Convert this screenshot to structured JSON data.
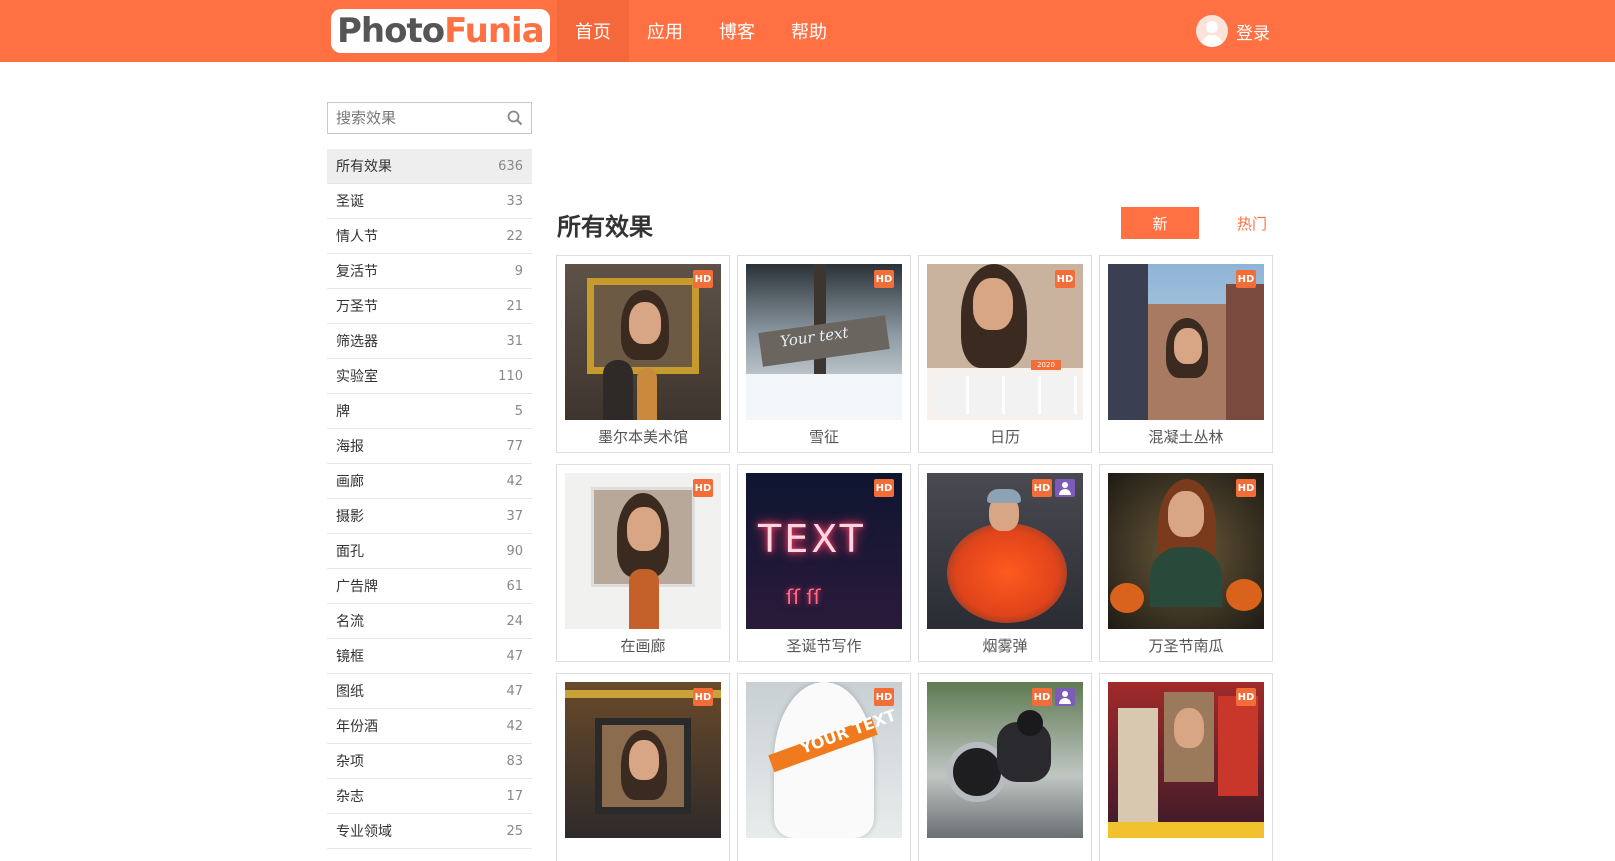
{
  "header": {
    "logo_part1": "Photo",
    "logo_part2": "Funia",
    "nav": [
      {
        "label": "首页",
        "active": true
      },
      {
        "label": "应用",
        "active": false
      },
      {
        "label": "博客",
        "active": false
      },
      {
        "label": "帮助",
        "active": false
      }
    ],
    "login_label": "登录"
  },
  "sidebar": {
    "search_placeholder": "搜索效果",
    "categories": [
      {
        "label": "所有效果",
        "count": "636",
        "active": true
      },
      {
        "label": "圣诞",
        "count": "33"
      },
      {
        "label": "情人节",
        "count": "22"
      },
      {
        "label": "复活节",
        "count": "9"
      },
      {
        "label": "万圣节",
        "count": "21"
      },
      {
        "label": "筛选器",
        "count": "31"
      },
      {
        "label": "实验室",
        "count": "110"
      },
      {
        "label": "牌",
        "count": "5"
      },
      {
        "label": "海报",
        "count": "77"
      },
      {
        "label": "画廊",
        "count": "42"
      },
      {
        "label": "摄影",
        "count": "37"
      },
      {
        "label": "面孔",
        "count": "90"
      },
      {
        "label": "广告牌",
        "count": "61"
      },
      {
        "label": "名流",
        "count": "24"
      },
      {
        "label": "镜框",
        "count": "47"
      },
      {
        "label": "图纸",
        "count": "47"
      },
      {
        "label": "年份酒",
        "count": "42"
      },
      {
        "label": "杂项",
        "count": "83"
      },
      {
        "label": "杂志",
        "count": "17"
      },
      {
        "label": "专业领域",
        "count": "25"
      }
    ]
  },
  "main": {
    "title": "所有效果",
    "sort_new": "新",
    "sort_hot": "热门",
    "hd_label": "HD",
    "effects": [
      {
        "label": "墨尔本美术馆",
        "art": "gallery-gold",
        "user_badge": false
      },
      {
        "label": "雪征",
        "art": "snow-sign",
        "user_badge": false,
        "art_text": "Your text"
      },
      {
        "label": "日历",
        "art": "calendar",
        "user_badge": false,
        "art_text": "2020"
      },
      {
        "label": "混凝土丛林",
        "art": "city",
        "user_badge": false
      },
      {
        "label": "在画廊",
        "art": "in-gallery",
        "user_badge": false
      },
      {
        "label": "圣诞节写作",
        "art": "neon-text",
        "user_badge": false,
        "art_text": "TEXT"
      },
      {
        "label": "烟雾弹",
        "art": "smoke",
        "user_badge": true
      },
      {
        "label": "万圣节南瓜",
        "art": "pumpkin",
        "user_badge": false
      },
      {
        "label": "",
        "art": "museum",
        "user_badge": false
      },
      {
        "label": "",
        "art": "surfboard",
        "user_badge": false,
        "art_text": "YOUR TEXT"
      },
      {
        "label": "",
        "art": "motorbike",
        "user_badge": true
      },
      {
        "label": "",
        "art": "billboards",
        "user_badge": false
      }
    ]
  },
  "colors": {
    "accent": "#ff7043",
    "hd_badge": "#f26d38",
    "user_badge": "#7c5cb8"
  }
}
